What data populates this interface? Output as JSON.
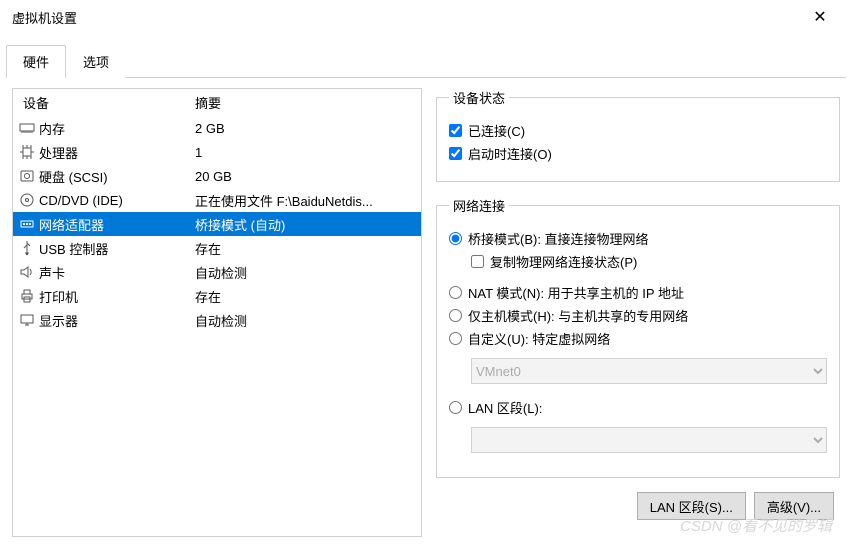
{
  "window": {
    "title": "虚拟机设置"
  },
  "tabs": {
    "hardware": "硬件",
    "options": "选项",
    "active": "hardware"
  },
  "columns": {
    "device": "设备",
    "summary": "摘要"
  },
  "devices": [
    {
      "icon": "memory-icon",
      "name": "内存",
      "summary": "2 GB"
    },
    {
      "icon": "cpu-icon",
      "name": "处理器",
      "summary": "1"
    },
    {
      "icon": "disk-icon",
      "name": "硬盘 (SCSI)",
      "summary": "20 GB"
    },
    {
      "icon": "cd-icon",
      "name": "CD/DVD (IDE)",
      "summary": "正在使用文件 F:\\BaiduNetdis..."
    },
    {
      "icon": "network-icon",
      "name": "网络适配器",
      "summary": "桥接模式 (自动)",
      "selected": true
    },
    {
      "icon": "usb-icon",
      "name": "USB 控制器",
      "summary": "存在"
    },
    {
      "icon": "sound-icon",
      "name": "声卡",
      "summary": "自动检测"
    },
    {
      "icon": "printer-icon",
      "name": "打印机",
      "summary": "存在"
    },
    {
      "icon": "display-icon",
      "name": "显示器",
      "summary": "自动检测"
    }
  ],
  "status_group": {
    "legend": "设备状态",
    "connected": {
      "label": "已连接(C)",
      "checked": true
    },
    "connect_at_power_on": {
      "label": "启动时连接(O)",
      "checked": true
    }
  },
  "network_group": {
    "legend": "网络连接",
    "bridged": {
      "label": "桥接模式(B): 直接连接物理网络",
      "selected": true
    },
    "replicate": {
      "label": "复制物理网络连接状态(P)",
      "checked": false
    },
    "nat": {
      "label": "NAT 模式(N): 用于共享主机的 IP 地址"
    },
    "hostonly": {
      "label": "仅主机模式(H): 与主机共享的专用网络"
    },
    "custom": {
      "label": "自定义(U): 特定虚拟网络",
      "combo": "VMnet0",
      "enabled": false
    },
    "lan_segment": {
      "label": "LAN 区段(L):",
      "combo": "",
      "enabled": false
    }
  },
  "buttons": {
    "lan_segments": "LAN 区段(S)...",
    "advanced": "高级(V)..."
  },
  "watermark": "CSDN @看不见的罗辑"
}
